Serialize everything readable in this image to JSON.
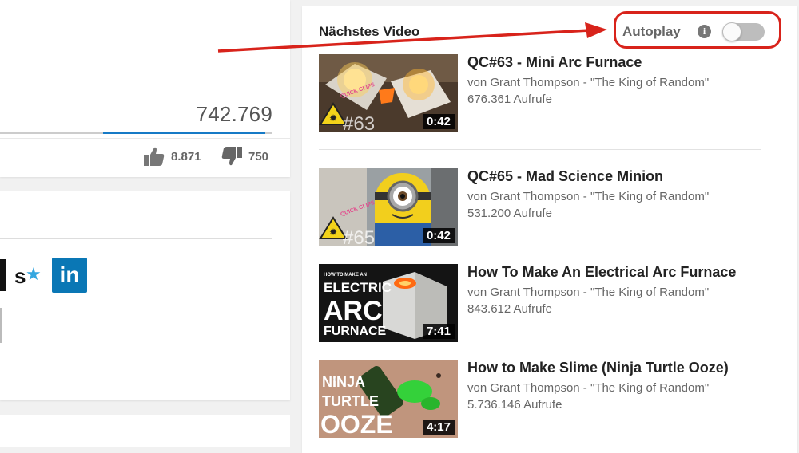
{
  "video_info": {
    "view_count": "742.769",
    "likes": "8.871",
    "dislikes": "750",
    "sentiment_like_fraction": 0.92
  },
  "share": {
    "close_glyph": "×",
    "stumble_letter": "s",
    "stumble_star": "★",
    "linkedin_label": "in"
  },
  "sidebar": {
    "heading": "Nächstes Video",
    "autoplay_label": "Autoplay",
    "info_glyph": "i",
    "autoplay_on": false,
    "annotation_color": "#d8231b",
    "videos": [
      {
        "title": "QC#63 - Mini Arc Furnace",
        "channel": "von Grant Thompson - \"The King of Random\"",
        "views": "676.361 Aufrufe",
        "duration": "0:42"
      },
      {
        "title": "QC#65 - Mad Science Minion",
        "channel": "von Grant Thompson - \"The King of Random\"",
        "views": "531.200 Aufrufe",
        "duration": "0:42"
      },
      {
        "title": "How To Make An Electrical Arc Furnace",
        "channel": "von Grant Thompson - \"The King of Random\"",
        "views": "843.612 Aufrufe",
        "duration": "7:41"
      },
      {
        "title": "How to Make Slime (Ninja Turtle Ooze)",
        "channel": "von Grant Thompson - \"The King of Random\"",
        "views": "5.736.146 Aufrufe",
        "duration": "4:17"
      }
    ],
    "thumb_texts": {
      "badge_63": "#63",
      "badge_65": "#65",
      "quick_clips": "QUICK CLIPS",
      "how_to_make_an": "HOW TO MAKE AN",
      "electric": "ELECTRIC",
      "arc": "ARC",
      "furnace": "FURNACE",
      "ninja": "NINJA",
      "turtle": "TURTLE",
      "ooze": "OOZE"
    }
  }
}
